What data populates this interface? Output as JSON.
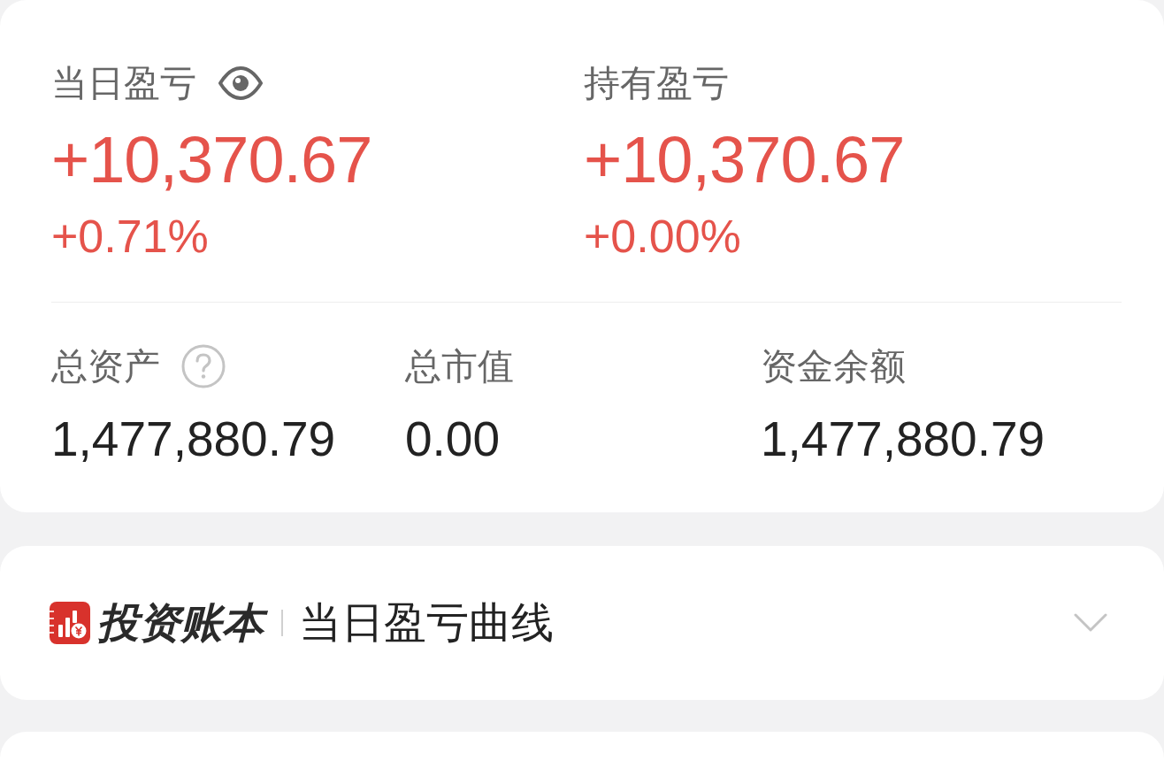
{
  "profit_summary": [
    {
      "label": "当日盈亏",
      "amount": "+10,370.67",
      "change": "+0.71%"
    },
    {
      "label": "持有盈亏",
      "amount": "+10,370.67",
      "change": "+0.00%"
    }
  ],
  "asset_summary": [
    {
      "label": "总资产",
      "value": "1,477,880.79"
    },
    {
      "label": "总市值",
      "value": "0.00"
    },
    {
      "label": "资金余额",
      "value": "1,477,880.79"
    }
  ],
  "chart_panel": {
    "brand": "投资账本",
    "title": "当日盈亏曲线",
    "expanded": false
  }
}
